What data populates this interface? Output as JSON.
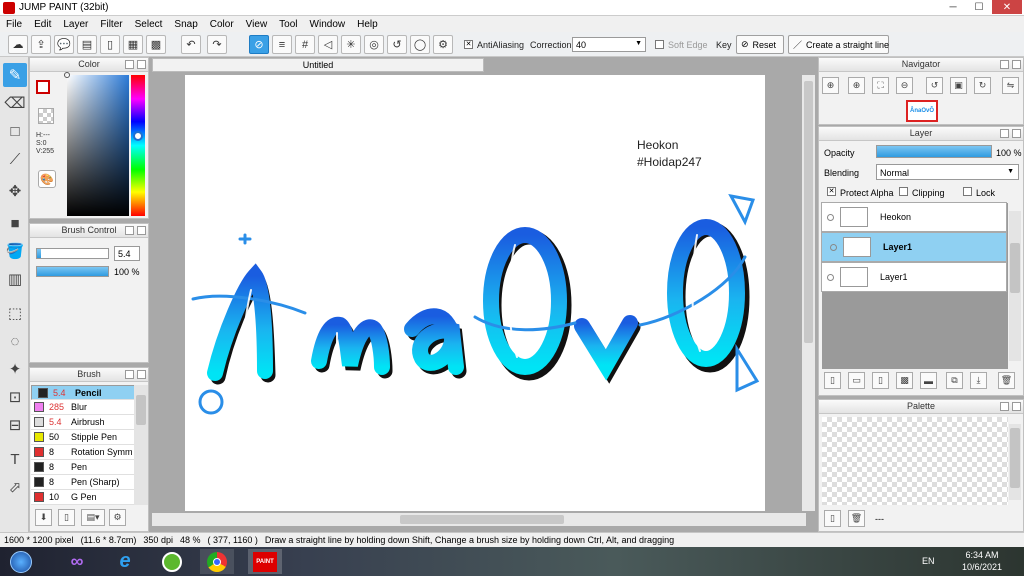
{
  "window": {
    "title": "JUMP PAINT (32bit)",
    "minimize": "─",
    "maximize": "☐",
    "close": "✕"
  },
  "menu": [
    "File",
    "Edit",
    "Layer",
    "Filter",
    "Select",
    "Snap",
    "Color",
    "View",
    "Tool",
    "Window",
    "Help"
  ],
  "toolbar": {
    "antialiasing_label": "AntiAliasing",
    "correction_label": "Correction",
    "correction_value": "40",
    "soft_edge_label": "Soft Edge",
    "key_label": "Key",
    "reset_label": "Reset",
    "straight_line_label": "Create a straight line"
  },
  "color_panel": {
    "title": "Color",
    "hsv": {
      "h": "H:---",
      "s": "S:0",
      "v": "V:255"
    },
    "fg_color": "#ffffff",
    "accent": "#cc0000"
  },
  "brush_control": {
    "title": "Brush Control",
    "size": "5.4",
    "opacity": "100 %",
    "size_fraction": 0.05,
    "opacity_fraction": 1.0
  },
  "brush": {
    "title": "Brush",
    "items": [
      {
        "size": "5.4",
        "name": "Pencil",
        "color": "#222222",
        "selected": true
      },
      {
        "size": "285",
        "name": "Blur",
        "color": "#f080f0",
        "selected": false
      },
      {
        "size": "5.4",
        "name": "Airbrush",
        "color": "#dddddd",
        "selected": false
      },
      {
        "size": "50",
        "name": "Stipple Pen",
        "color": "#e8e800",
        "selected": false
      },
      {
        "size": "8",
        "name": "Rotation Symm",
        "color": "#e03030",
        "selected": false
      },
      {
        "size": "8",
        "name": "Pen",
        "color": "#222222",
        "selected": false
      },
      {
        "size": "8",
        "name": "Pen (Sharp)",
        "color": "#222222",
        "selected": false
      },
      {
        "size": "10",
        "name": "G Pen",
        "color": "#e03030",
        "selected": false
      }
    ]
  },
  "document": {
    "tab": "Untitled",
    "text_line1": "Heokon",
    "text_line2": "#Hoidap247",
    "artwork_text": "ÂnaOvÔ"
  },
  "navigator": {
    "title": "Navigator"
  },
  "layer_panel": {
    "title": "Layer",
    "opacity_label": "Opacity",
    "opacity_value": "100 %",
    "blending_label": "Blending",
    "blending_value": "Normal",
    "protect_alpha": "Protect Alpha",
    "clipping": "Clipping",
    "lock": "Lock",
    "layers": [
      {
        "name": "Heokon",
        "selected": false
      },
      {
        "name": "Layer1",
        "selected": true
      },
      {
        "name": "Layer1",
        "selected": false
      }
    ]
  },
  "palette": {
    "title": "Palette",
    "dashes": "---"
  },
  "status": {
    "size": "1600 * 1200 pixel",
    "cm": "(11.6 * 8.7cm)",
    "dpi": "350 dpi",
    "zoom": "48 %",
    "coords": "( 377, 1160 )",
    "hint": "Draw a straight line by holding down Shift, Change a brush size by holding down Ctrl, Alt, and dragging"
  },
  "taskbar": {
    "lang": "EN",
    "time": "6:34 AM",
    "date": "10/6/2021"
  }
}
